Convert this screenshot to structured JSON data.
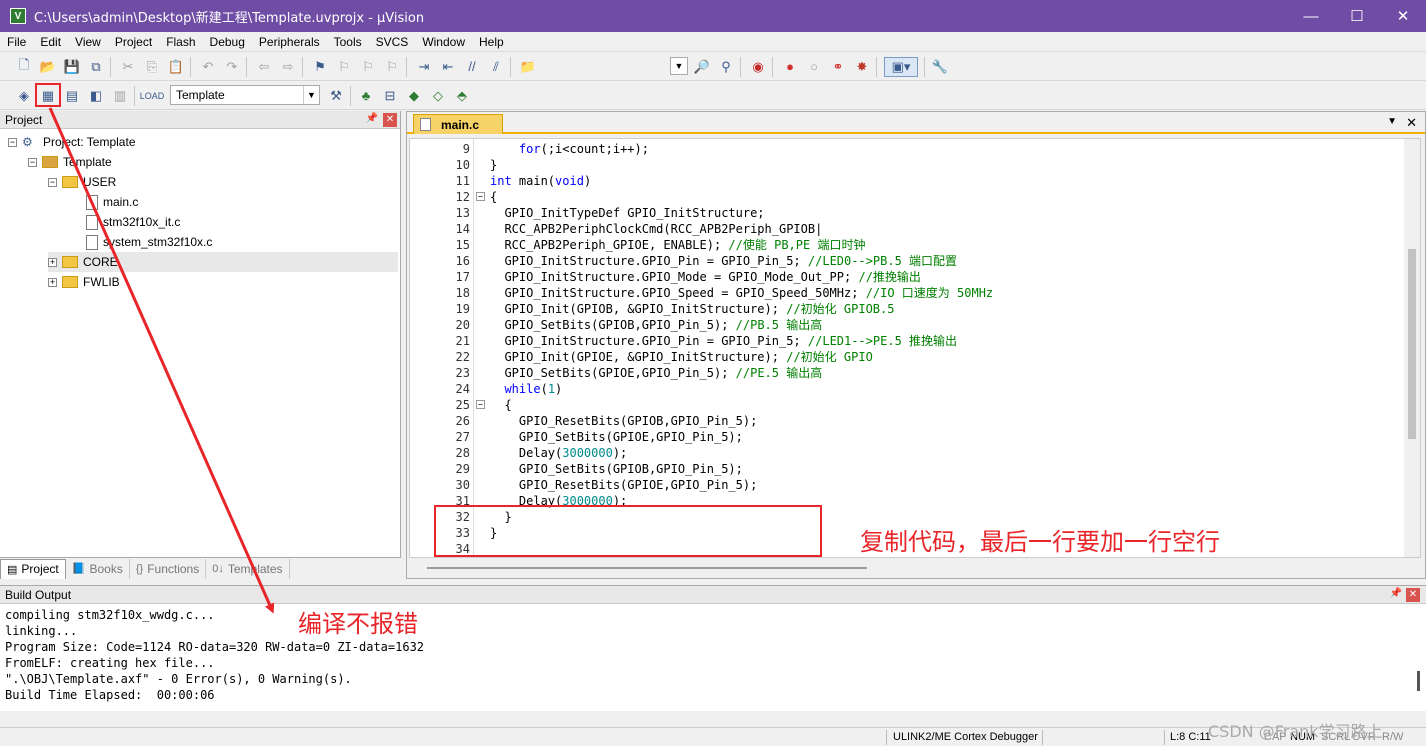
{
  "window": {
    "title": "C:\\Users\\admin\\Desktop\\新建工程\\Template.uvprojx - µVision",
    "minimize": "—",
    "maximize": "☐",
    "close": "✕"
  },
  "menu": [
    "File",
    "Edit",
    "View",
    "Project",
    "Flash",
    "Debug",
    "Peripherals",
    "Tools",
    "SVCS",
    "Window",
    "Help"
  ],
  "toolbar": {
    "target": "Template"
  },
  "project_panel": {
    "title": "Project",
    "tree": {
      "root": "Project: Template",
      "target": "Template",
      "user_folder": "USER",
      "files": [
        "main.c",
        "stm32f10x_it.c",
        "system_stm32f10x.c"
      ],
      "core_folder": "CORE",
      "fwlib_folder": "FWLIB"
    },
    "tabs": [
      "Project",
      "Books",
      "Functions",
      "Templates"
    ]
  },
  "editor": {
    "active_tab": "main.c",
    "lines": [
      {
        "n": "9",
        "segs": [
          {
            "t": "    ",
            "c": ""
          },
          {
            "t": "for",
            "c": "kw"
          },
          {
            "t": "(;i<count;i++);",
            "c": ""
          }
        ]
      },
      {
        "n": "10",
        "segs": [
          {
            "t": "}",
            "c": ""
          }
        ]
      },
      {
        "n": "11",
        "segs": [
          {
            "t": "int",
            "c": "kw"
          },
          {
            "t": " main(",
            "c": ""
          },
          {
            "t": "void",
            "c": "kw"
          },
          {
            "t": ")",
            "c": ""
          }
        ]
      },
      {
        "n": "12",
        "segs": [
          {
            "t": "{",
            "c": ""
          }
        ]
      },
      {
        "n": "13",
        "segs": [
          {
            "t": "  GPIO_InitTypeDef GPIO_InitStructure;",
            "c": ""
          }
        ]
      },
      {
        "n": "14",
        "segs": [
          {
            "t": "  RCC_APB2PeriphClockCmd(RCC_APB2Periph_GPIOB|",
            "c": ""
          }
        ]
      },
      {
        "n": "15",
        "segs": [
          {
            "t": "  RCC_APB2Periph_GPIOE, ENABLE); ",
            "c": ""
          },
          {
            "t": "//使能 PB,PE 端口时钟",
            "c": "cm"
          }
        ]
      },
      {
        "n": "16",
        "segs": [
          {
            "t": "  GPIO_InitStructure.GPIO_Pin = GPIO_Pin_5; ",
            "c": ""
          },
          {
            "t": "//LED0-->PB.5 端口配置",
            "c": "cm"
          }
        ]
      },
      {
        "n": "17",
        "segs": [
          {
            "t": "  GPIO_InitStructure.GPIO_Mode = GPIO_Mode_Out_PP; ",
            "c": ""
          },
          {
            "t": "//推挽输出",
            "c": "cm"
          }
        ]
      },
      {
        "n": "18",
        "segs": [
          {
            "t": "  GPIO_InitStructure.GPIO_Speed = GPIO_Speed_50MHz; ",
            "c": ""
          },
          {
            "t": "//IO 口速度为 50MHz",
            "c": "cm"
          }
        ]
      },
      {
        "n": "19",
        "segs": [
          {
            "t": "  GPIO_Init(GPIOB, &GPIO_InitStructure); ",
            "c": ""
          },
          {
            "t": "//初始化 GPIOB.5",
            "c": "cm"
          }
        ]
      },
      {
        "n": "20",
        "segs": [
          {
            "t": "  GPIO_SetBits(GPIOB,GPIO_Pin_5); ",
            "c": ""
          },
          {
            "t": "//PB.5 输出高",
            "c": "cm"
          }
        ]
      },
      {
        "n": "21",
        "segs": [
          {
            "t": "  GPIO_InitStructure.GPIO_Pin = GPIO_Pin_5; ",
            "c": ""
          },
          {
            "t": "//LED1-->PE.5 推挽输出",
            "c": "cm"
          }
        ]
      },
      {
        "n": "22",
        "segs": [
          {
            "t": "  GPIO_Init(GPIOE, &GPIO_InitStructure); ",
            "c": ""
          },
          {
            "t": "//初始化 GPIO",
            "c": "cm"
          }
        ]
      },
      {
        "n": "23",
        "segs": [
          {
            "t": "  GPIO_SetBits(GPIOE,GPIO_Pin_5); ",
            "c": ""
          },
          {
            "t": "//PE.5 输出高",
            "c": "cm"
          }
        ]
      },
      {
        "n": "24",
        "segs": [
          {
            "t": "  ",
            "c": ""
          },
          {
            "t": "while",
            "c": "kw"
          },
          {
            "t": "(",
            "c": ""
          },
          {
            "t": "1",
            "c": "num"
          },
          {
            "t": ")",
            "c": ""
          }
        ]
      },
      {
        "n": "25",
        "segs": [
          {
            "t": "  {",
            "c": ""
          }
        ]
      },
      {
        "n": "26",
        "segs": [
          {
            "t": "    GPIO_ResetBits(GPIOB,GPIO_Pin_5);",
            "c": ""
          }
        ]
      },
      {
        "n": "27",
        "segs": [
          {
            "t": "    GPIO_SetBits(GPIOE,GPIO_Pin_5);",
            "c": ""
          }
        ]
      },
      {
        "n": "28",
        "segs": [
          {
            "t": "    Delay(",
            "c": ""
          },
          {
            "t": "3000000",
            "c": "num"
          },
          {
            "t": ");",
            "c": ""
          }
        ]
      },
      {
        "n": "29",
        "segs": [
          {
            "t": "    GPIO_SetBits(GPIOB,GPIO_Pin_5);",
            "c": ""
          }
        ]
      },
      {
        "n": "30",
        "segs": [
          {
            "t": "    GPIO_ResetBits(GPIOE,GPIO_Pin_5);",
            "c": ""
          }
        ]
      },
      {
        "n": "31",
        "segs": [
          {
            "t": "    Delay(",
            "c": ""
          },
          {
            "t": "3000000",
            "c": "num"
          },
          {
            "t": ");",
            "c": ""
          }
        ]
      },
      {
        "n": "32",
        "segs": [
          {
            "t": "  }",
            "c": ""
          }
        ]
      },
      {
        "n": "33",
        "segs": [
          {
            "t": "}",
            "c": ""
          }
        ]
      },
      {
        "n": "34",
        "segs": [
          {
            "t": "",
            "c": ""
          }
        ]
      }
    ]
  },
  "build_output": {
    "title": "Build Output",
    "lines": [
      "compiling stm32f10x_wwdg.c...",
      "linking...",
      "Program Size: Code=1124 RO-data=320 RW-data=0 ZI-data=1632",
      "FromELF: creating hex file...",
      "\".\\OBJ\\Template.axf\" - 0 Error(s), 0 Warning(s).",
      "Build Time Elapsed:  00:00:06"
    ]
  },
  "status": {
    "debugger": "ULINK2/ME Cortex Debugger",
    "position": "L:8 C:11",
    "caps": "CAP",
    "num": "NUM",
    "scrl": "SCRL",
    "ovr": "OVR",
    "rw": "R/W"
  },
  "annotations": {
    "copy_note": "复制代码，最后一行要加一行空行",
    "build_note": "编译不报错",
    "watermark": "CSDN @Frank学习路上"
  },
  "colors": {
    "titlebar": "#6f4da5",
    "annotation_red": "#e8262a",
    "keyword": "#0000ff",
    "comment": "#008000",
    "number": "#008b8b",
    "active_tab": "#f7d266"
  }
}
